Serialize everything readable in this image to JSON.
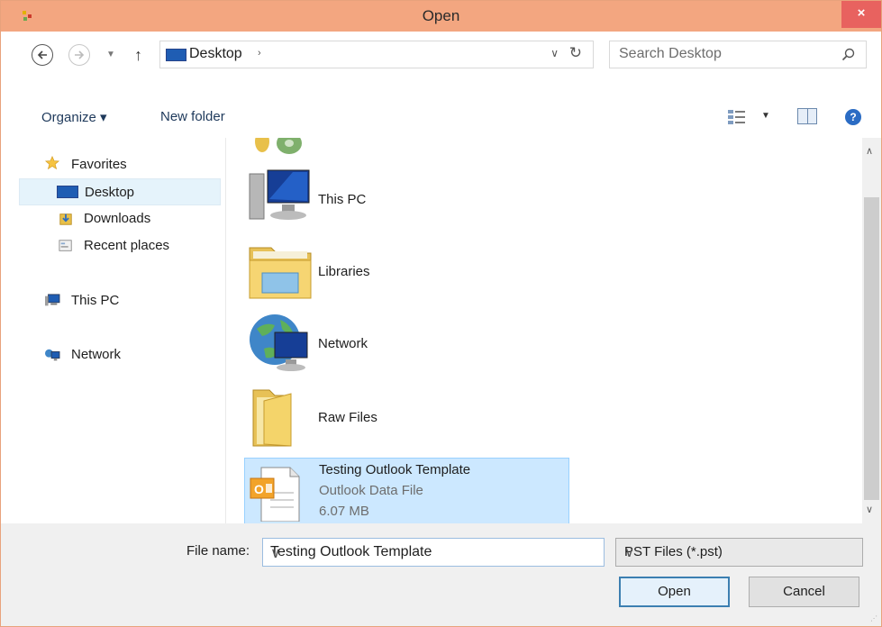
{
  "window": {
    "title": "Open",
    "close_label": "×"
  },
  "address": {
    "location": "Desktop",
    "separator": "›"
  },
  "search": {
    "placeholder": "Search Desktop"
  },
  "toolbar": {
    "organize_label": "Organize ▾",
    "new_folder_label": "New folder",
    "help_label": "?"
  },
  "sidebar": {
    "items": [
      {
        "label": "Favorites",
        "icon": "star-icon"
      },
      {
        "label": "Desktop",
        "icon": "desktop-icon",
        "selected": true
      },
      {
        "label": "Downloads",
        "icon": "downloads-icon"
      },
      {
        "label": "Recent places",
        "icon": "recent-places-icon"
      },
      {
        "label": "This PC",
        "icon": "computer-icon"
      },
      {
        "label": "Network",
        "icon": "network-icon"
      }
    ]
  },
  "files": [
    {
      "name": "This PC",
      "icon": "computer-icon"
    },
    {
      "name": "Libraries",
      "icon": "libraries-icon"
    },
    {
      "name": "Network",
      "icon": "network-globe-icon"
    },
    {
      "name": "Raw Files",
      "icon": "folder-icon"
    },
    {
      "name": "Testing Outlook Template",
      "type": "Outlook Data File",
      "size": "6.07 MB",
      "icon": "outlook-file-icon",
      "selected": true
    }
  ],
  "footer": {
    "file_name_label": "File name:",
    "file_name_value": "Testing Outlook Template",
    "file_type_value": "PST Files (*.pst)",
    "open_label": "Open",
    "cancel_label": "Cancel"
  },
  "colors": {
    "titlebar": "#f3a680",
    "close": "#e8625f",
    "selection": "#cce8ff",
    "accent": "#3c7fb1"
  }
}
